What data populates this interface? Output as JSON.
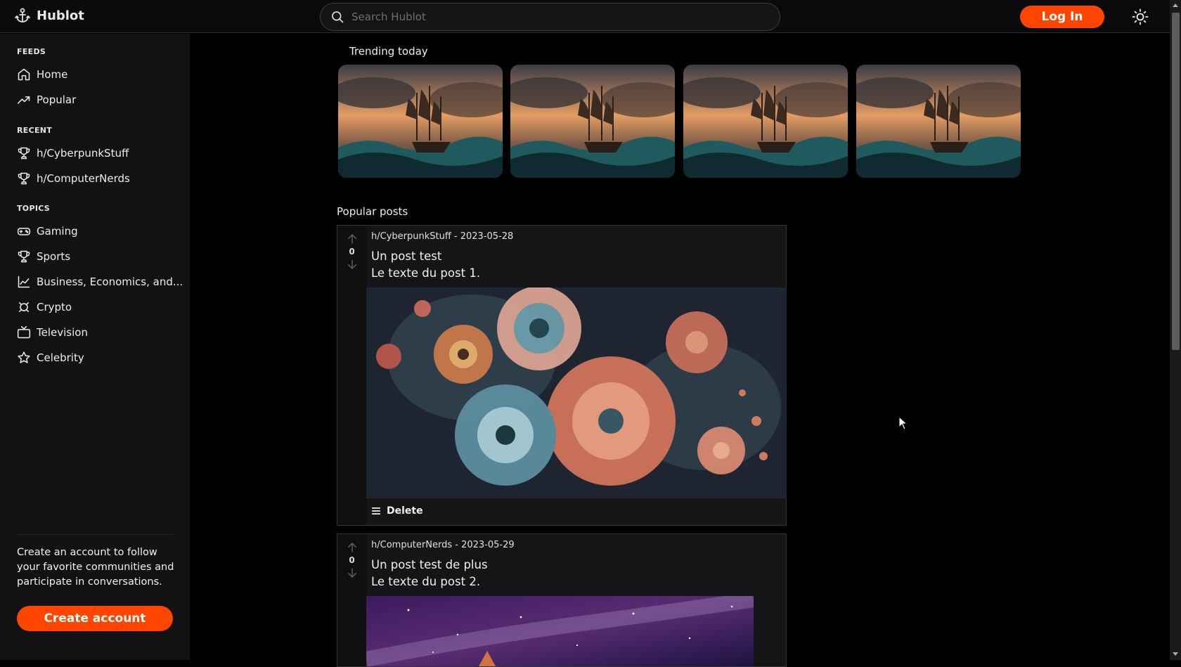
{
  "header": {
    "logo_text": "Hublot",
    "search_placeholder": "Search Hublot",
    "login_label": "Log In"
  },
  "sidebar": {
    "feeds_title": "FEEDS",
    "feeds": [
      {
        "label": "Home",
        "icon": "home-icon"
      },
      {
        "label": "Popular",
        "icon": "trending-up-icon"
      }
    ],
    "recent_title": "RECENT",
    "recent": [
      {
        "label": "h/CyberpunkStuff",
        "icon": "trophy-icon"
      },
      {
        "label": "h/ComputerNerds",
        "icon": "trophy-icon"
      }
    ],
    "topics_title": "TOPICS",
    "topics": [
      {
        "label": "Gaming",
        "icon": "gamepad-icon"
      },
      {
        "label": "Sports",
        "icon": "trophy-icon"
      },
      {
        "label": "Business, Economics, and...",
        "icon": "line-chart-icon"
      },
      {
        "label": "Crypto",
        "icon": "bitcoin-icon"
      },
      {
        "label": "Television",
        "icon": "tv-icon"
      },
      {
        "label": "Celebrity",
        "icon": "star-icon"
      }
    ],
    "cta_text": "Create an account to follow your favorite communities and participate in conversations.",
    "create_account_label": "Create account"
  },
  "main": {
    "trending_title": "Trending today",
    "popular_title": "Popular posts",
    "posts": [
      {
        "meta": "h/CyberpunkStuff - 2023-05-28",
        "title": "Un post test",
        "body": "Le texte du post 1.",
        "score": "0",
        "delete_label": "Delete"
      },
      {
        "meta": "h/ComputerNerds - 2023-05-29",
        "title": "Un post test de plus",
        "body": "Le texte du post 2.",
        "score": "0"
      }
    ]
  },
  "colors": {
    "accent": "#ff4500",
    "background": "#000000",
    "sidebar": "#121213"
  }
}
